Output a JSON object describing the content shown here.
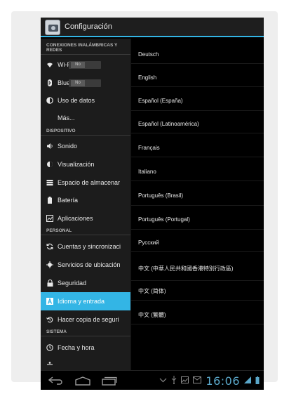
{
  "app": {
    "title": "Configuración"
  },
  "sections": {
    "wireless": "CONEXIONES INALÁMBRICAS Y REDES",
    "device": "DISPOSITIVO",
    "personal": "PERSONAL",
    "system": "SISTEMA"
  },
  "menu": {
    "wifi": {
      "label": "Wi-Fi",
      "toggle": "No"
    },
    "bluetooth": {
      "label": "Bluetoot",
      "toggle": "No"
    },
    "data_usage": "Uso de datos",
    "more": "Más...",
    "sound": "Sonido",
    "display": "Visualización",
    "storage": "Espacio de almacenar",
    "battery": "Batería",
    "apps": "Aplicaciones",
    "accounts": "Cuentas y sincronizaci",
    "location": "Servicios de ubicación",
    "security": "Seguridad",
    "language": "Idioma y entrada",
    "backup": "Hacer copia de seguri",
    "date": "Fecha y hora"
  },
  "languages": [
    "Deutsch",
    "English",
    "Español (España)",
    "Español (Latinoamérica)",
    "Français",
    "Italiano",
    "Português (Brasil)",
    "Português (Portugal)",
    "Русский",
    "中文 (中華人民共和國香港特別行政區)",
    "中文 (简体)",
    "中文 (繁體)"
  ],
  "status": {
    "time": "16:06"
  },
  "colors": {
    "accent": "#33b5e5",
    "clock": "#5aa7c9"
  }
}
